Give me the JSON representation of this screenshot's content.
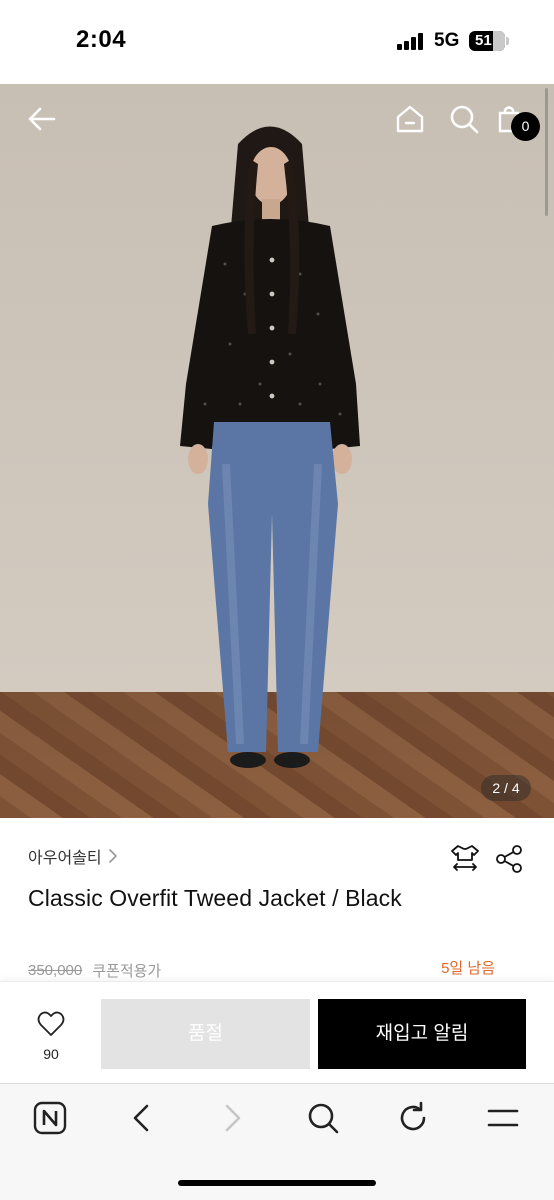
{
  "status_bar": {
    "time": "2:04",
    "network": "5G",
    "battery": "51"
  },
  "header": {
    "cart_count": "0",
    "icons": [
      "back-arrow-icon",
      "home-icon",
      "search-icon",
      "cart-icon"
    ]
  },
  "gallery": {
    "page_indicator": "2 / 4",
    "current_page": 2,
    "total_pages": 4
  },
  "product": {
    "brand": "아우어솔티",
    "title": "Classic Overfit Tweed Jacket / Black",
    "original_price": "350,000",
    "coupon_label": "쿠폰적용가",
    "days_left": "5일 남음"
  },
  "actions": {
    "like_count": "90",
    "soldout_label": "품절",
    "restock_label": "재입고 알림"
  },
  "colors": {
    "accent_orange": "#e0662b",
    "primary_black": "#000000",
    "disabled_gray": "#e3e3e3"
  }
}
